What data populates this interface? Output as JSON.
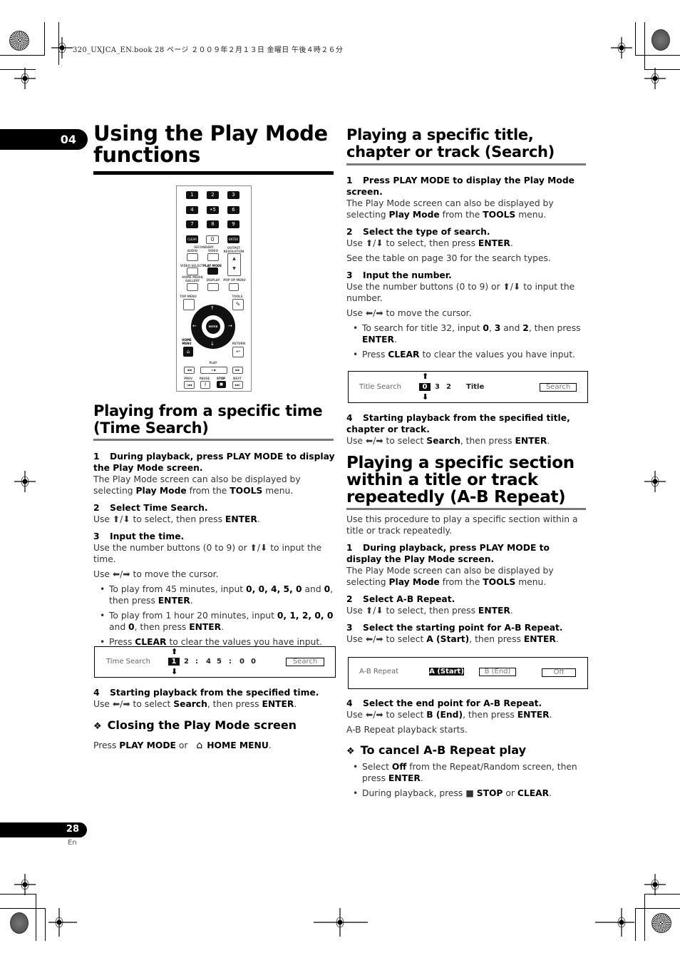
{
  "print_header": "320_UXJCA_EN.book  28 ページ  ２００９年２月１３日  金曜日  午後４時２６分",
  "chapter": {
    "number": "04",
    "title": "Using the Play Mode functions"
  },
  "remote": {
    "number_keys": [
      "1",
      "2",
      "3",
      "4",
      "•5",
      "6",
      "7",
      "8",
      "9"
    ],
    "clear": "CLEAR",
    "zero": "0",
    "enter": "ENTER",
    "labels": {
      "secondary": "SECONDARY",
      "audio": "AUDIO",
      "video": "VIDEO",
      "output_resolution": "OUTPUT RESOLUTION",
      "video_select": "VIDEO SELECT",
      "play_mode": "PLAY MODE",
      "home_media_gallery": "HOME MEDIA GALLERY",
      "display": "DISPLAY",
      "popup_menu": "POP UP MENU",
      "top_menu": "TOP MENU",
      "tools": "TOOLS",
      "home_menu": "HOME MENU",
      "return": "RETURN",
      "play": "PLAY",
      "prev": "PREV",
      "pause": "PAUSE",
      "stop": "STOP",
      "next": "NEXT",
      "dpad_enter": "ENTER"
    }
  },
  "time_search": {
    "heading": "Playing from a specific time (Time Search)",
    "steps": [
      {
        "num": "1",
        "title": "During playback, press PLAY MODE to display the Play Mode screen.",
        "body_pre": "The Play Mode screen can also be displayed by selecting ",
        "b1": "Play Mode",
        "mid": " from the ",
        "b2": "TOOLS",
        "post": " menu."
      },
      {
        "num": "2",
        "title": "Select Time Search.",
        "body_pre": "Use ⬆/⬇ to select, then press ",
        "b1": "ENTER",
        "post": "."
      },
      {
        "num": "3",
        "title": "Input the time.",
        "body1": "Use the number buttons (0 to 9) or ⬆/⬇ to input the time.",
        "body2": "Use ⬅/➡ to move the cursor."
      },
      {
        "num": "4",
        "title": "Starting playback from the specified time.",
        "body_pre": "Use ⬅/➡ to select ",
        "b1": "Search",
        "mid": ", then press ",
        "b2": "ENTER",
        "post": "."
      }
    ],
    "bullets": [
      {
        "pre": "To play from 45 minutes, input ",
        "vals": "0, 0, 4, 5, 0",
        "and": " and ",
        "last": "0",
        "post": ", then press ",
        "enter": "ENTER",
        "end": "."
      },
      {
        "pre": "To play from 1 hour 20 minutes, input ",
        "vals": "0, 1, 2, 0, 0",
        "and": " and ",
        "last": "0",
        "post": ", then press ",
        "enter": "ENTER",
        "end": "."
      },
      {
        "pre": "Press ",
        "clear": "CLEAR",
        "post": " to clear the values you have input."
      }
    ],
    "screen": {
      "label": "Time Search",
      "selected": "1",
      "digits": [
        "2",
        ":",
        "4",
        "5",
        ":",
        "0",
        "0"
      ],
      "button": "Search"
    },
    "closing": {
      "heading": "Closing the Play Mode screen",
      "pre": "Press ",
      "b1": "PLAY MODE",
      "or": " or ",
      "b2": "HOME MENU",
      "post": "."
    }
  },
  "title_search": {
    "heading": "Playing a specific title, chapter or track (Search)",
    "steps": [
      {
        "num": "1",
        "title": "Press PLAY MODE to display the Play Mode screen.",
        "body_pre": "The Play Mode screen can also be displayed by selecting ",
        "b1": "Play Mode",
        "mid": " from the ",
        "b2": "TOOLS",
        "post": " menu."
      },
      {
        "num": "2",
        "title": "Select the type of search.",
        "body_pre": "Use ⬆/⬇ to select, then press ",
        "b1": "ENTER",
        "post": ".",
        "note": "See the table on page 30 for the search types."
      },
      {
        "num": "3",
        "title": "Input the number.",
        "body1": "Use the number buttons (0 to 9) or ⬆/⬇ to input the number.",
        "body2": "Use ⬅/➡ to move the cursor."
      },
      {
        "num": "4",
        "title": "Starting playback from the specified title, chapter or track.",
        "body_pre": "Use ⬅/➡ to select ",
        "b1": "Search",
        "mid": ", then press ",
        "b2": "ENTER",
        "post": "."
      }
    ],
    "bullets": [
      {
        "pre": "To search for title 32, input ",
        "v1": "0",
        "c": ", ",
        "v2": "3",
        "and": " and ",
        "v3": "2",
        "post": ", then press ",
        "enter": "ENTER",
        "end": "."
      },
      {
        "pre": "Press ",
        "clear": "CLEAR",
        "post": " to clear the values you have input."
      }
    ],
    "screen": {
      "label": "Title Search",
      "selected": "0",
      "digits": [
        "3",
        "2"
      ],
      "type": "Title",
      "button": "Search"
    }
  },
  "ab_repeat": {
    "heading": "Playing a specific section within a title or track repeatedly (A-B Repeat)",
    "intro": "Use this procedure to play a specific section within a title or track repeatedly.",
    "steps": [
      {
        "num": "1",
        "title": "During playback, press PLAY MODE to display the Play Mode screen.",
        "body_pre": "The Play Mode screen can also be displayed by selecting ",
        "b1": "Play Mode",
        "mid": " from the ",
        "b2": "TOOLS",
        "post": " menu."
      },
      {
        "num": "2",
        "title": "Select A-B Repeat.",
        "body_pre": "Use ⬆/⬇ to select, then press ",
        "b1": "ENTER",
        "post": "."
      },
      {
        "num": "3",
        "title": "Select the starting point for A-B Repeat.",
        "body_pre": "Use ⬅/➡ to select ",
        "b1": "A (Start)",
        "mid": ", then press ",
        "b2": "ENTER",
        "post": "."
      },
      {
        "num": "4",
        "title": "Select the end point for A-B Repeat.",
        "body_pre": "Use ⬅/➡ to select ",
        "b1": "B (End)",
        "mid": ", then press ",
        "b2": "ENTER",
        "post": ".",
        "note": "A-B Repeat playback starts."
      }
    ],
    "screen": {
      "label": "A-B Repeat",
      "selected": "A (Start)",
      "option_b": "B (End)",
      "off": "Off"
    },
    "cancel": {
      "heading": "To cancel A-B Repeat play",
      "bullets": [
        {
          "pre": "Select ",
          "b1": "Off",
          "mid": " from the Repeat/Random screen, then press ",
          "b2": "ENTER",
          "post": "."
        },
        {
          "pre": "During playback, press ■ ",
          "b1": "STOP",
          "mid": " or ",
          "b2": "CLEAR",
          "post": "."
        }
      ]
    }
  },
  "footer": {
    "page_number": "28",
    "lang": "En"
  }
}
